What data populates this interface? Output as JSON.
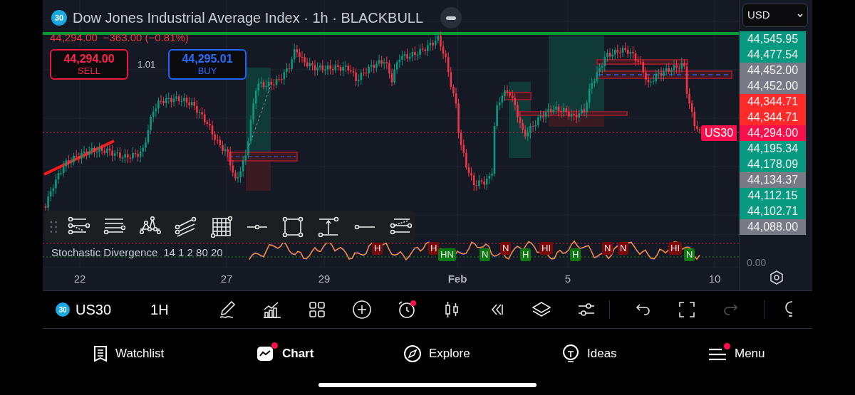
{
  "header": {
    "badge": "30",
    "title": "Dow Jones Industrial Average Index · 1h · BLACKBULL"
  },
  "quote": {
    "price": "44,294.00",
    "change": "−363.00 (−0.81%)"
  },
  "trade": {
    "sell_price": "44,294.00",
    "sell_label": "SELL",
    "spread": "1.01",
    "buy_price": "44,295.01",
    "buy_label": "BUY"
  },
  "currency": "USD",
  "price_labels": [
    {
      "text": "44,545.95",
      "color": "#089981"
    },
    {
      "text": "44,477.54",
      "color": "#089981"
    },
    {
      "text": "44,452.00",
      "color": "#787b86"
    },
    {
      "text": "44,452.00",
      "color": "#787b86"
    },
    {
      "text": "44,344.71",
      "color": "#ff2a2a"
    },
    {
      "text": "44,344.71",
      "color": "#ff2a2a"
    },
    {
      "text": "44,294.00",
      "color": "#f7104b"
    },
    {
      "text": "44,195.34",
      "color": "#089981"
    },
    {
      "text": "44,178.09",
      "color": "#089981"
    },
    {
      "text": "44,134.37",
      "color": "#787b86"
    },
    {
      "text": "44,112.15",
      "color": "#089981"
    },
    {
      "text": "44,102.71",
      "color": "#089981"
    },
    {
      "text": "44,088.00",
      "color": "#787b86"
    }
  ],
  "current_symbol_tag": "US30",
  "indicator": {
    "name": "Stochastic Divergence",
    "params": "14 1 2 80 20",
    "value": "0.00",
    "markers": [
      {
        "text": "H",
        "color": "#7a0a0a"
      },
      {
        "text": "H",
        "color": "#7a0a0a"
      },
      {
        "text": "HN",
        "color": "#0f7a12"
      },
      {
        "text": "N",
        "color": "#0f7a12"
      },
      {
        "text": "N",
        "color": "#7a0a0a"
      },
      {
        "text": "H",
        "color": "#0f7a12"
      },
      {
        "text": "HI",
        "color": "#7a0a0a"
      },
      {
        "text": "H",
        "color": "#0f7a12"
      },
      {
        "text": "N",
        "color": "#7a0a0a"
      },
      {
        "text": "N",
        "color": "#7a0a0a"
      },
      {
        "text": "HI",
        "color": "#7a0a0a"
      },
      {
        "text": "N",
        "color": "#0f7a12"
      }
    ]
  },
  "x_axis": [
    {
      "text": "22",
      "bold": false
    },
    {
      "text": "27",
      "bold": false
    },
    {
      "text": "29",
      "bold": false
    },
    {
      "text": "Feb",
      "bold": true
    },
    {
      "text": "5",
      "bold": false
    },
    {
      "text": "10",
      "bold": false
    }
  ],
  "bottom_toolbar": {
    "badge": "30",
    "symbol": "US30",
    "interval": "1H",
    "alert_dot": true,
    "redo_disabled": true
  },
  "nav": [
    {
      "label": "Watchlist",
      "selected": false,
      "dot": false
    },
    {
      "label": "Chart",
      "selected": true,
      "dot": true
    },
    {
      "label": "Explore",
      "selected": false,
      "dot": false
    },
    {
      "label": "Ideas",
      "selected": false,
      "dot": false
    },
    {
      "label": "Menu",
      "selected": false,
      "dot": true
    }
  ]
}
